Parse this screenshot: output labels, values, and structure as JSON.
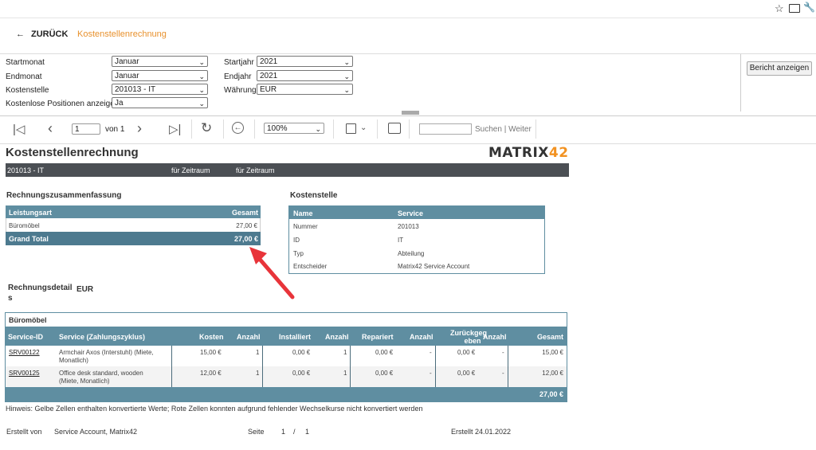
{
  "header": {
    "back_label": "ZURÜCK",
    "breadcrumb": "Kostenstellenrechnung"
  },
  "params": {
    "start_month_label": "Startmonat",
    "start_month_value": "Januar",
    "end_month_label": "Endmonat",
    "end_month_value": "Januar",
    "cost_center_label": "Kostenstelle",
    "cost_center_value": "201013 - IT",
    "free_items_label": "Kostenlose Positionen anzeigen",
    "free_items_value": "Ja",
    "start_year_label": "Startjahr",
    "start_year_value": "2021",
    "end_year_label": "Endjahr",
    "end_year_value": "2021",
    "currency_label": "Währung",
    "currency_value": "EUR",
    "show_report_label": "Bericht anzeigen"
  },
  "toolbar": {
    "page_value": "1",
    "page_of": "von 1",
    "zoom_value": "100%",
    "search_label": "Suchen",
    "search_sep": "|",
    "next_label": "Weiter"
  },
  "report": {
    "title": "Kostenstellenrechnung",
    "logo_main": "MATRIX",
    "logo_accent": "42",
    "bar_cost_center": "201013 - IT",
    "bar_period1": "für Zeitraum",
    "bar_period2": "für Zeitraum",
    "summary": {
      "title": "Rechnungszusammenfassung",
      "col_type": "Leistungsart",
      "col_total": "Gesamt",
      "row_name": "Büromöbel",
      "row_value": "27,00 €",
      "grand_label": "Grand Total",
      "grand_value": "27,00 €"
    },
    "cost_center": {
      "title": "Kostenstelle",
      "col_name": "Name",
      "col_service": "Service",
      "rows": [
        {
          "k": "Nummer",
          "v": "201013"
        },
        {
          "k": "ID",
          "v": "IT"
        },
        {
          "k": "Typ",
          "v": "Abteilung"
        },
        {
          "k": "Entscheider",
          "v": "Matrix42 Service Account"
        }
      ]
    },
    "details": {
      "title_line1": "Rechnungsdetail",
      "title_line2": "s",
      "currency": "EUR",
      "group": "Büromöbel",
      "columns": [
        "Service-ID",
        "Service (Zahlungszyklus)",
        "Kosten",
        "Anzahl",
        "Installiert",
        "Anzahl",
        "Repariert",
        "Anzahl",
        "Zurückgeg",
        "eben",
        "Anzahl",
        "Gesamt"
      ],
      "rows": [
        {
          "id": "SRV00122",
          "svc1": "Armchair Axos (Interstuhl) (Miete,",
          "svc2": "Monatlich)",
          "kosten": "15,00 €",
          "anz1": "1",
          "inst": "0,00 €",
          "anz2": "1",
          "rep": "0,00 €",
          "anz3": "-",
          "zur": "0,00 €",
          "anz4": "-",
          "ges": "15,00 €"
        },
        {
          "id": "SRV00125",
          "svc1": "Office desk standard, wooden",
          "svc2": "(Miete, Monatlich)",
          "kosten": "12,00 €",
          "anz1": "1",
          "inst": "0,00 €",
          "anz2": "1",
          "rep": "0,00 €",
          "anz3": "-",
          "zur": "0,00 €",
          "anz4": "-",
          "ges": "12,00 €"
        }
      ],
      "total": "27,00 €"
    },
    "note": "Hinweis: Gelbe Zellen enthalten konvertierte Werte; Rote Zellen konnten aufgrund fehlender Wechselkurse nicht konvertiert werden",
    "footer": {
      "created_by_label": "Erstellt von",
      "created_by_value": "Service Account, Matrix42",
      "page_label": "Seite",
      "page_current": "1",
      "page_sep": "/",
      "page_total": "1",
      "created_on": "Erstellt 24.01.2022"
    }
  },
  "colors": {
    "accent": "#e8912d",
    "table_header": "#5f8ea1",
    "dark_bar": "#4b4f54",
    "arrow": "#e8343a"
  },
  "icons": [
    "star-icon",
    "monitor-icon",
    "wrench-icon",
    "back-arrow-icon",
    "first-page-icon",
    "prev-page-icon",
    "next-page-icon",
    "last-page-icon",
    "refresh-icon",
    "back-circle-icon",
    "save-icon",
    "print-icon"
  ]
}
